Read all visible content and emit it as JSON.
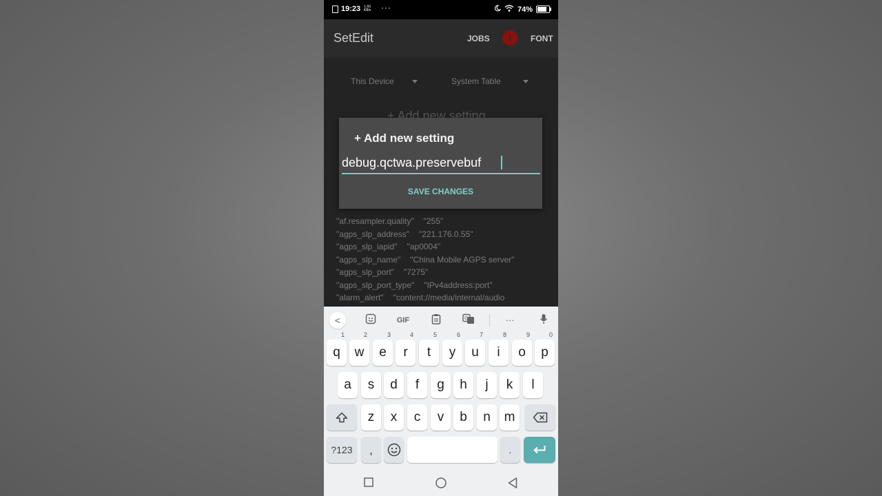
{
  "status_bar": {
    "time": "19:23",
    "net_speed": "1.60 KB/s",
    "more": "···",
    "battery": "74%"
  },
  "app_bar": {
    "title": "SetEdit",
    "jobs_label": "JOBS",
    "alert_badge": "!",
    "font_label": "FONT"
  },
  "filters": {
    "device": "This Device",
    "table": "System Table"
  },
  "background_hint": "+ Add new setting",
  "settings_rows": [
    {
      "key": "af.resampler.quality",
      "value": "255"
    },
    {
      "key": "agps_slp_address",
      "value": "221.176.0.55"
    },
    {
      "key": "agps_slp_iapid",
      "value": "ap0004"
    },
    {
      "key": "agps_slp_name",
      "value": "China Mobile AGPS server"
    },
    {
      "key": "agps_slp_port",
      "value": "7275"
    },
    {
      "key": "agps_slp_port_type",
      "value": "IPv4address:port"
    },
    {
      "key": "alarm_alert",
      "value": "content://media/internal/audio"
    }
  ],
  "dialog": {
    "title": "+ Add new setting",
    "input_value": "debug.qctwa.preservebuf",
    "save_label": "SAVE CHANGES"
  },
  "keyboard": {
    "toolbar": {
      "back": "<",
      "gif": "GIF",
      "more": "···"
    },
    "row1": [
      {
        "k": "q",
        "h": "1"
      },
      {
        "k": "w",
        "h": "2"
      },
      {
        "k": "e",
        "h": "3"
      },
      {
        "k": "r",
        "h": "4"
      },
      {
        "k": "t",
        "h": "5"
      },
      {
        "k": "y",
        "h": "6"
      },
      {
        "k": "u",
        "h": "7"
      },
      {
        "k": "i",
        "h": "8"
      },
      {
        "k": "o",
        "h": "9"
      },
      {
        "k": "p",
        "h": "0"
      }
    ],
    "row2": [
      "a",
      "s",
      "d",
      "f",
      "g",
      "h",
      "j",
      "k",
      "l"
    ],
    "row3": [
      "z",
      "x",
      "c",
      "v",
      "b",
      "n",
      "m"
    ],
    "symbols": "?123",
    "comma": ",",
    "period": "."
  },
  "accent_color": "#5aaeb0"
}
